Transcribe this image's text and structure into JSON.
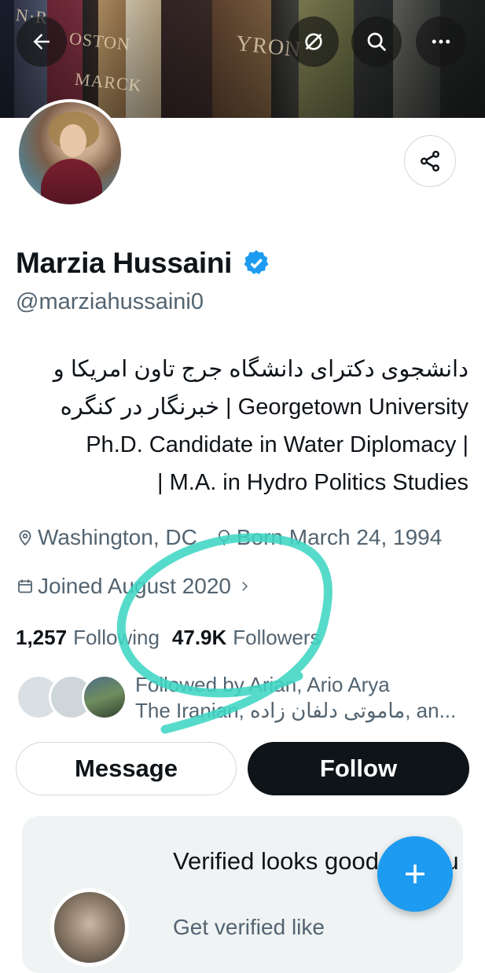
{
  "profile": {
    "name": "Marzia Hussaini",
    "handle": "@marziahussaini0",
    "bio_lines": [
      "دانشجوی دکترای دانشگاه جرج تاون امریکا و",
      "خبرنگار در کنگره  |  Georgetown University",
      "Ph.D. Candidate in Water Diplomacy |",
      "| M.A. in Hydro Politics Studies"
    ],
    "location": "Washington, DC",
    "birthday": "Born March 24, 1994",
    "joined": "Joined August 2020",
    "following_count": "1,257",
    "following_label": "Following",
    "followers_count": "47.9K",
    "followers_label": "Followers",
    "followed_by_line1": "Followed by Arian, Ario Arya",
    "followed_by_line2": "The Iranian, ماموتی دلفان زاده, an..."
  },
  "actions": {
    "message_label": "Message",
    "follow_label": "Follow"
  },
  "promo": {
    "title": "Verified looks good on you",
    "subtitle": "Get verified like"
  },
  "icons": {
    "back": "arrow-left-icon",
    "translate_off": "slashed-circle-icon",
    "search": "search-icon",
    "more": "more-horizontal-icon",
    "share": "share-icon",
    "verified": "verified-badge-icon",
    "location": "location-pin-icon",
    "birthday": "balloon-icon",
    "calendar": "calendar-icon",
    "compose": "plus-icon"
  },
  "colors": {
    "accent": "#1d9bf0",
    "text_primary": "#0f1419",
    "text_secondary": "#536471",
    "annotation_marker": "#3fd6c4"
  }
}
